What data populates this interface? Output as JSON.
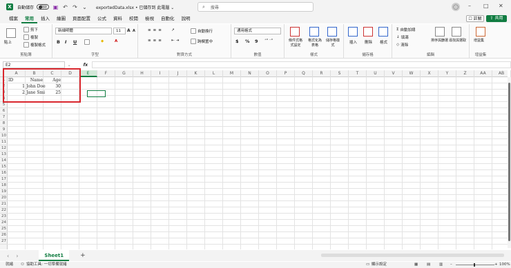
{
  "app": {
    "autosave_label": "自動儲存",
    "autosave_state": "關閉",
    "filename": "exportedData.xlsx • 已儲存到 此電腦 ⌄",
    "search_placeholder": "搜尋"
  },
  "tabs": [
    "檔案",
    "常用",
    "插入",
    "繪圖",
    "頁面配置",
    "公式",
    "資料",
    "校閱",
    "檢視",
    "自動化",
    "說明"
  ],
  "active_tab": "常用",
  "buttons": {
    "comment": "註解",
    "share": "共用"
  },
  "ribbon": {
    "clipboard": {
      "label": "剪貼簿",
      "paste": "貼上",
      "cut": "剪下",
      "copy": "複製",
      "format_painter": "複製格式"
    },
    "font": {
      "label": "字型",
      "font_name": "新細明體",
      "font_size": "11",
      "bold": "B",
      "italic": "I",
      "underline": "U",
      "grow": "A",
      "shrink": "A"
    },
    "alignment": {
      "label": "對齊方式",
      "wrap": "自動換行",
      "merge": "跨欄置中"
    },
    "number": {
      "label": "數值",
      "format": "通用格式",
      "currency": "$",
      "percent": "%",
      "comma": "9"
    },
    "styles": {
      "label": "樣式",
      "conditional": "條件式格式設定",
      "table": "格式化為表格",
      "cell_styles": "儲存格樣式"
    },
    "cells": {
      "label": "儲存格",
      "insert": "插入",
      "delete": "刪除",
      "format": "格式"
    },
    "editing": {
      "label": "編輯",
      "autosum": "自動加總",
      "fill": "填滿",
      "clear": "清除",
      "sort": "排序與篩選",
      "find": "尋找與選取"
    },
    "addins": {
      "label": "增益集",
      "addins": "增益集"
    }
  },
  "name_box": "E2",
  "fx_label": "fx",
  "columns": [
    "A",
    "B",
    "C",
    "D",
    "E",
    "F",
    "G",
    "H",
    "I",
    "J",
    "K",
    "L",
    "M",
    "N",
    "O",
    "P",
    "Q",
    "R",
    "S",
    "T",
    "U",
    "V",
    "W",
    "X",
    "Y",
    "Z",
    "AA",
    "AB"
  ],
  "selected_column": "E",
  "rows": [
    "1",
    "2",
    "3",
    "4",
    "5",
    "6",
    "7",
    "8",
    "9",
    "10",
    "11",
    "12",
    "13",
    "14",
    "15",
    "16",
    "17",
    "18",
    "19",
    "20",
    "21",
    "22",
    "23",
    "24",
    "25",
    "26",
    "27"
  ],
  "cell_data": [
    {
      "col": 0,
      "row": 0,
      "text": "ID",
      "align": "left"
    },
    {
      "col": 1,
      "row": 0,
      "text": "Name",
      "align": "right"
    },
    {
      "col": 2,
      "row": 0,
      "text": "Age",
      "align": "right"
    },
    {
      "col": 0,
      "row": 1,
      "text": "1",
      "align": "right"
    },
    {
      "col": 1,
      "row": 1,
      "text": "John Doe",
      "align": "left"
    },
    {
      "col": 2,
      "row": 1,
      "text": "30",
      "align": "right"
    },
    {
      "col": 0,
      "row": 2,
      "text": "2",
      "align": "right"
    },
    {
      "col": 1,
      "row": 2,
      "text": "Jane Smi",
      "align": "left"
    },
    {
      "col": 2,
      "row": 2,
      "text": "25",
      "align": "right"
    }
  ],
  "sheets": [
    "Sheet1"
  ],
  "status": {
    "ready": "就緒",
    "accessibility": "協助工具: 一切準備就緒",
    "display_settings": "顯示設定",
    "zoom": "100%"
  }
}
